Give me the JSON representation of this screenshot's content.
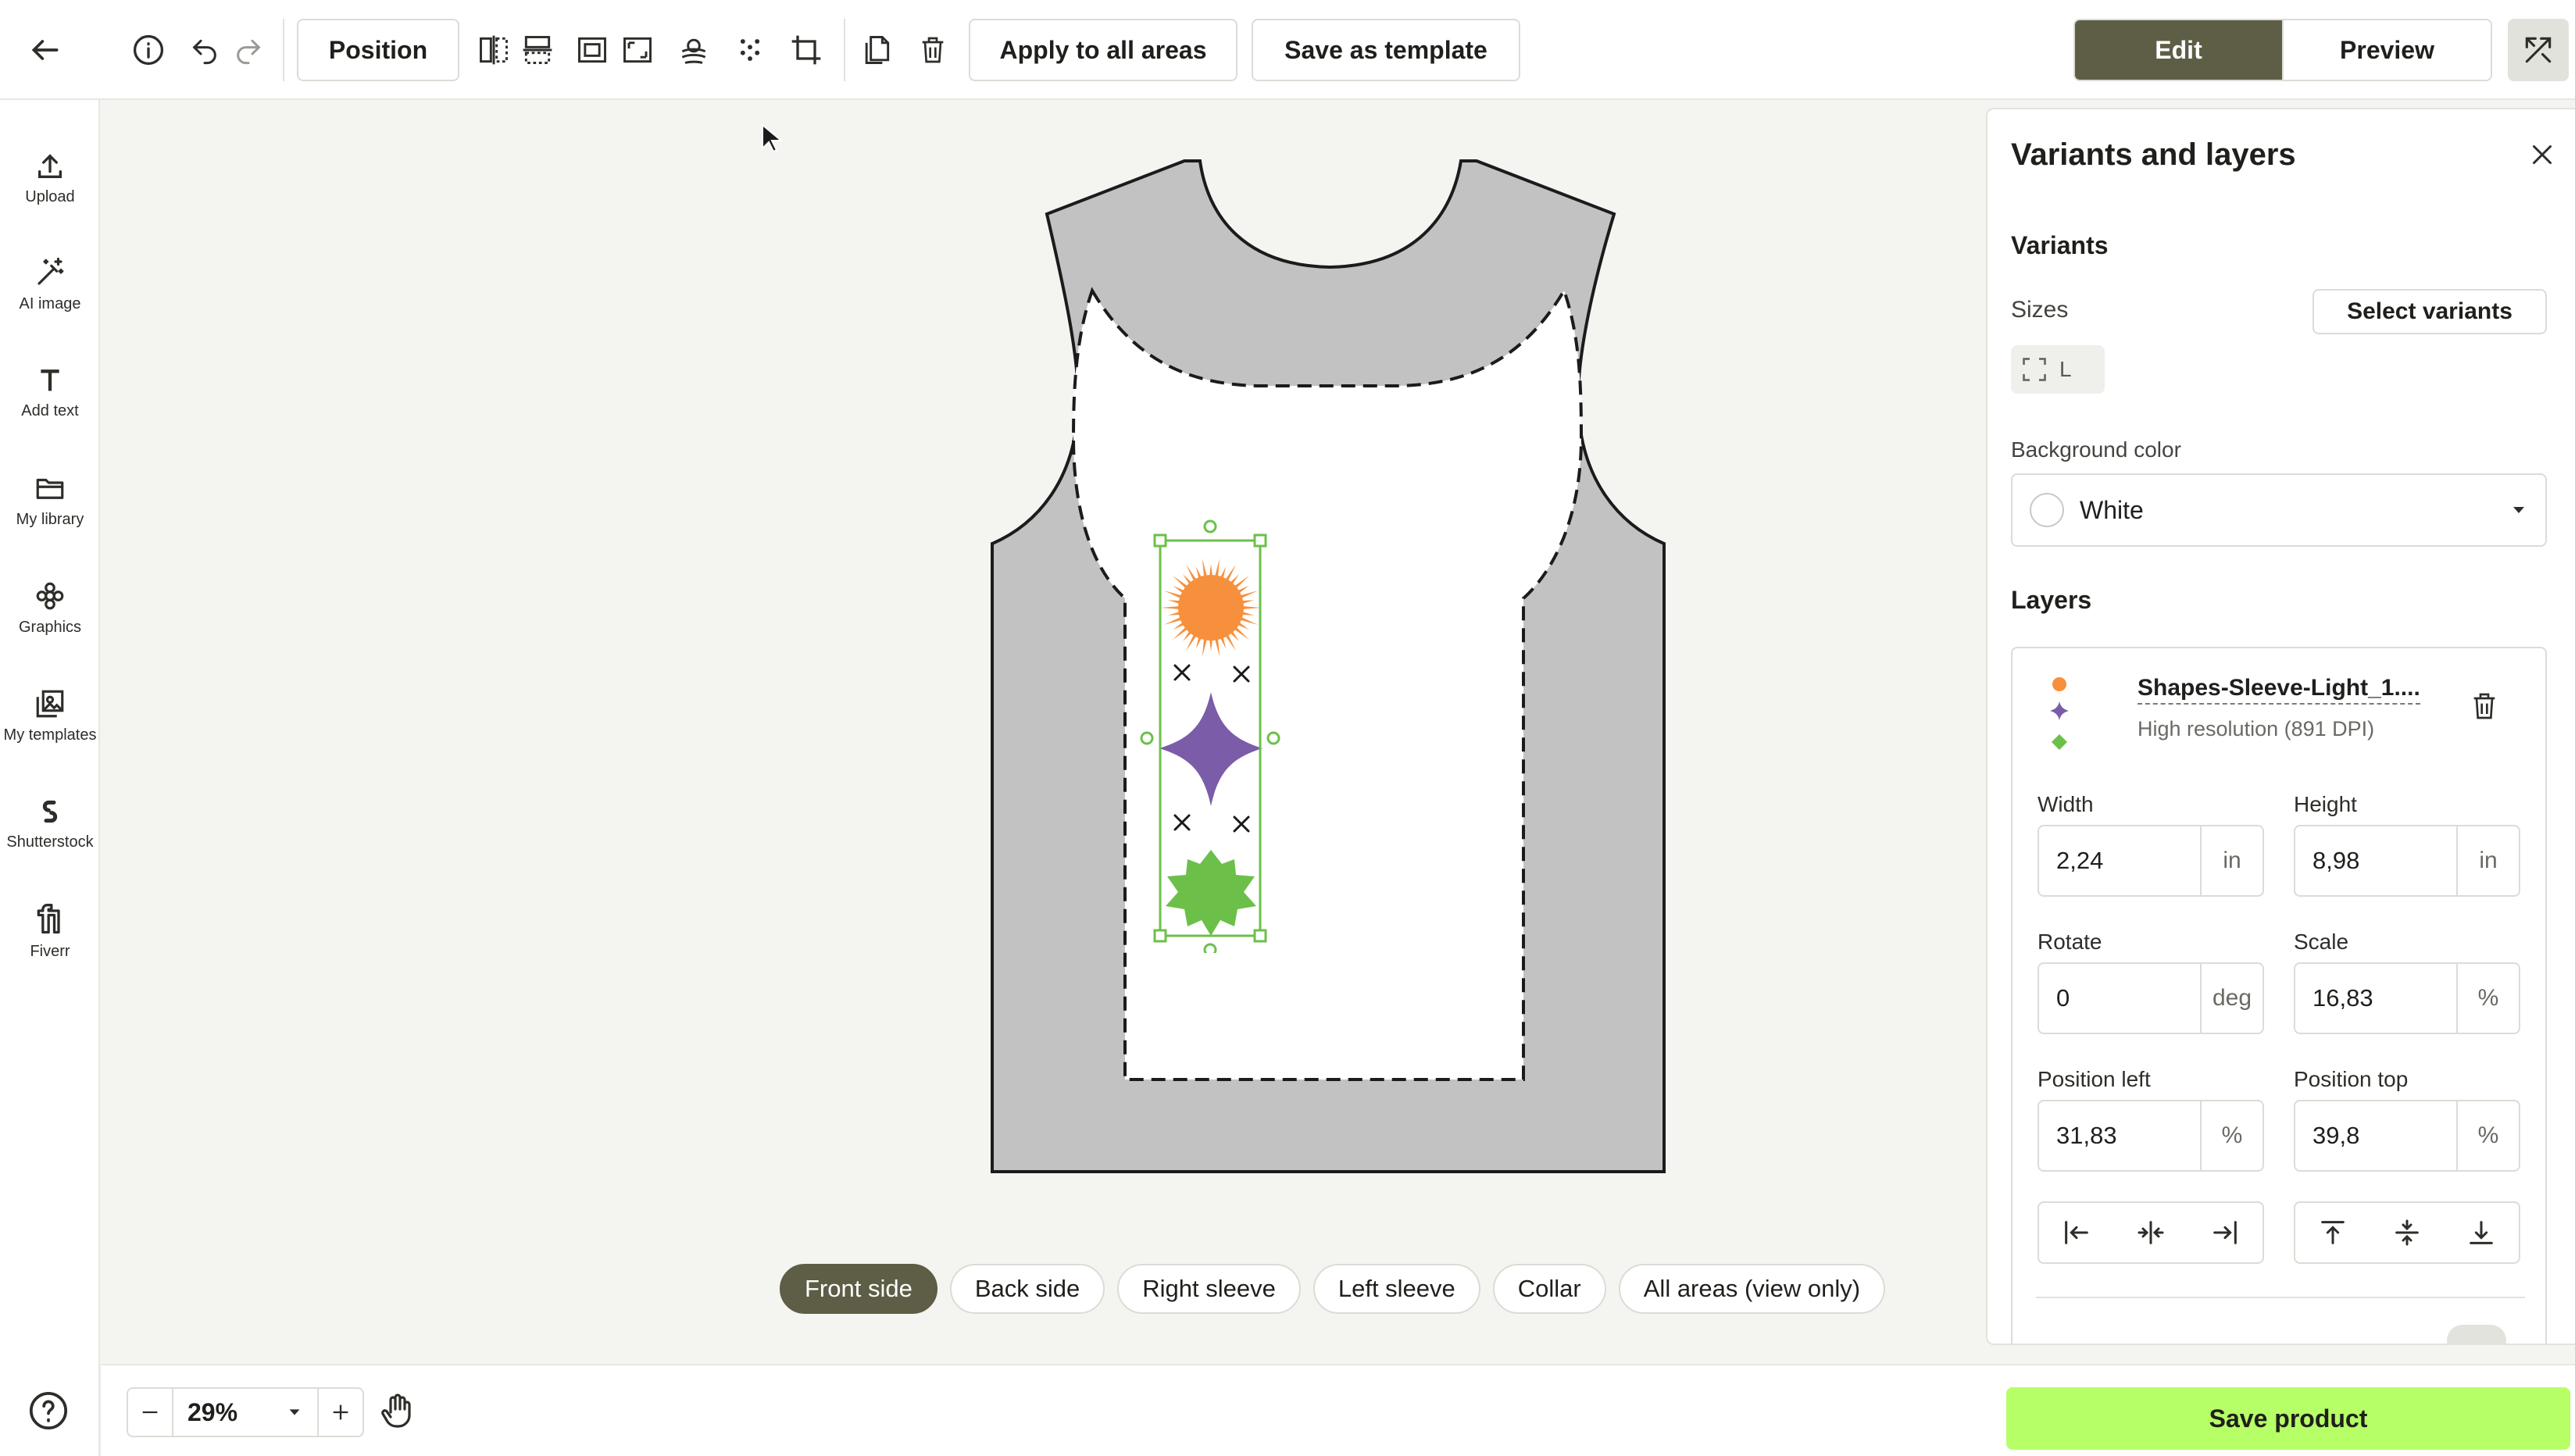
{
  "toolbar": {
    "position_label": "Position",
    "apply_all_label": "Apply to all areas",
    "save_template_label": "Save as template",
    "mode_edit": "Edit",
    "mode_preview": "Preview"
  },
  "sidebar": {
    "items": [
      {
        "label": "Upload",
        "icon": "upload-icon"
      },
      {
        "label": "AI image",
        "icon": "magic-wand-icon"
      },
      {
        "label": "Add text",
        "icon": "text-icon"
      },
      {
        "label": "My library",
        "icon": "folder-icon"
      },
      {
        "label": "Graphics",
        "icon": "flower-icon"
      },
      {
        "label": "My templates",
        "icon": "templates-icon"
      },
      {
        "label": "Shutterstock",
        "icon": "shutterstock-icon"
      },
      {
        "label": "Fiverr",
        "icon": "fiverr-icon"
      }
    ]
  },
  "canvas": {
    "tabs": [
      "Front side",
      "Back side",
      "Right sleeve",
      "Left sleeve",
      "Collar",
      "All areas (view only)"
    ],
    "active_tab": "Front side"
  },
  "bottom": {
    "zoom": "29%",
    "save_product": "Save product"
  },
  "panel": {
    "title": "Variants and layers",
    "variants_heading": "Variants",
    "sizes_label": "Sizes",
    "select_variants": "Select variants",
    "size_value": "L",
    "bg_color_label": "Background color",
    "bg_color_value": "White",
    "layers_heading": "Layers",
    "layer": {
      "name": "Shapes-Sleeve-Light_1....",
      "resolution": "High resolution (891 DPI)",
      "width_label": "Width",
      "width": "2,24",
      "width_unit": "in",
      "height_label": "Height",
      "height": "8,98",
      "height_unit": "in",
      "rotate_label": "Rotate",
      "rotate": "0",
      "rotate_unit": "deg",
      "scale_label": "Scale",
      "scale": "16,83",
      "scale_unit": "%",
      "pos_left_label": "Position left",
      "pos_left": "31,83",
      "pos_left_unit": "%",
      "pos_top_label": "Position top",
      "pos_top": "39,8",
      "pos_top_unit": "%"
    }
  },
  "colors": {
    "accent_dark": "#5e5d45",
    "save_green": "#b6ff66",
    "selection_green": "#6cc04a",
    "sun_orange": "#f7903c",
    "star_purple": "#7b5ca8",
    "burst_green": "#6cc04a",
    "garment_gray": "#c2c2c2"
  }
}
